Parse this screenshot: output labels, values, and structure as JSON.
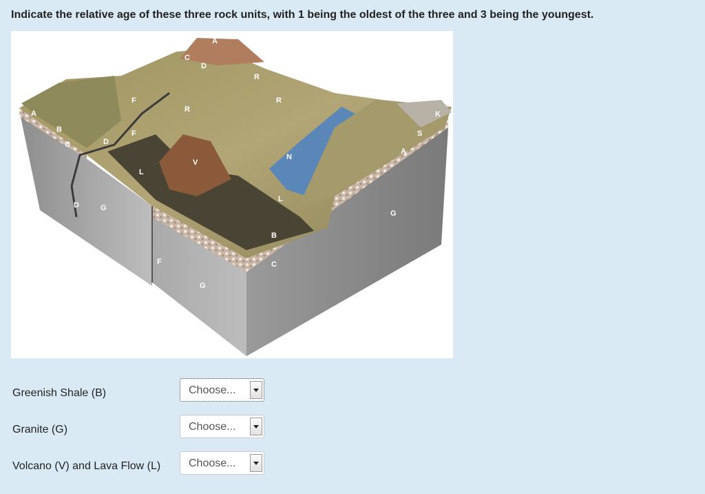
{
  "question": "Indicate the relative age of these three rock units, with 1 being the oldest of the three and 3 being the youngest.",
  "figure": {
    "labels": [
      "A",
      "C",
      "D",
      "R",
      "R",
      "R",
      "A",
      "B",
      "C",
      "D",
      "F",
      "F",
      "V",
      "L",
      "N",
      "L",
      "K",
      "S",
      "A",
      "D",
      "G",
      "G",
      "B",
      "C",
      "F",
      "G"
    ]
  },
  "rows": [
    {
      "label": "Greenish Shale (B)",
      "select_value": "Choose..."
    },
    {
      "label": "Granite (G)",
      "select_value": "Choose..."
    },
    {
      "label": "Volcano (V) and Lava Flow (L)",
      "select_value": "Choose..."
    }
  ],
  "icons": {
    "dropdown": "chevron-down-icon"
  }
}
